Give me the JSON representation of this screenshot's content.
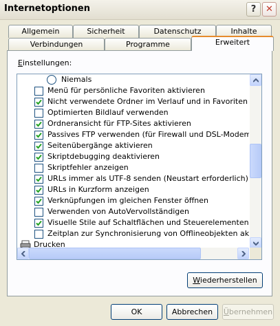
{
  "window": {
    "title": "Internetoptionen",
    "help_label": "?",
    "close_label": "✕"
  },
  "tabs_back": [
    "Allgemein",
    "Sicherheit",
    "Datenschutz",
    "Inhalte"
  ],
  "tabs_front": [
    "Verbindungen",
    "Programme",
    "Erweitert"
  ],
  "active_tab": "Erweitert",
  "panel": {
    "label_accel": "E",
    "label_rest": "instellungen:"
  },
  "settings": [
    {
      "type": "radio",
      "label": "Niemals",
      "checked": false
    },
    {
      "type": "checkbox",
      "label": "Menü für persönliche Favoriten aktivieren",
      "checked": false
    },
    {
      "type": "checkbox",
      "label": "Nicht verwendete Ordner im Verlauf und in Favoriten schließen",
      "checked": true
    },
    {
      "type": "checkbox",
      "label": "Optimierten Bildlauf verwenden",
      "checked": false
    },
    {
      "type": "checkbox",
      "label": "Ordneransicht für FTP-Sites aktivieren",
      "checked": true
    },
    {
      "type": "checkbox",
      "label": "Passives FTP verwenden (für Firewall und DSL-Modem-Kompatibilität)",
      "checked": true
    },
    {
      "type": "checkbox",
      "label": "Seitenübergänge aktivieren",
      "checked": true
    },
    {
      "type": "checkbox",
      "label": "Skriptdebugging deaktivieren",
      "checked": true
    },
    {
      "type": "checkbox",
      "label": "Skriptfehler anzeigen",
      "checked": false
    },
    {
      "type": "checkbox",
      "label": "URLs immer als UTF-8 senden (Neustart erforderlich)",
      "checked": true
    },
    {
      "type": "checkbox",
      "label": "URLs in Kurzform anzeigen",
      "checked": true
    },
    {
      "type": "checkbox",
      "label": "Verknüpfungen im gleichen Fenster öffnen",
      "checked": true
    },
    {
      "type": "checkbox",
      "label": "Verwenden von AutoVervollständigen",
      "checked": false
    },
    {
      "type": "checkbox",
      "label": "Visuelle Stile auf Schaltflächen und Steuerelementen in Webseiten aktivieren",
      "checked": true
    },
    {
      "type": "checkbox",
      "label": "Zeitplan zur Synchronisierung von Offlineobjekten aktivieren",
      "checked": false
    },
    {
      "type": "category",
      "label": "Drucken",
      "icon": "printer-icon"
    }
  ],
  "buttons": {
    "restore_accel": "W",
    "restore_rest": "iederherstellen",
    "ok": "OK",
    "cancel": "Abbrechen",
    "apply_accel": "Ü",
    "apply_rest": "bernehmen"
  },
  "colors": {
    "accent_tab": "#e68b2c",
    "checkmark": "#21a121",
    "button_border": "#003c74"
  }
}
